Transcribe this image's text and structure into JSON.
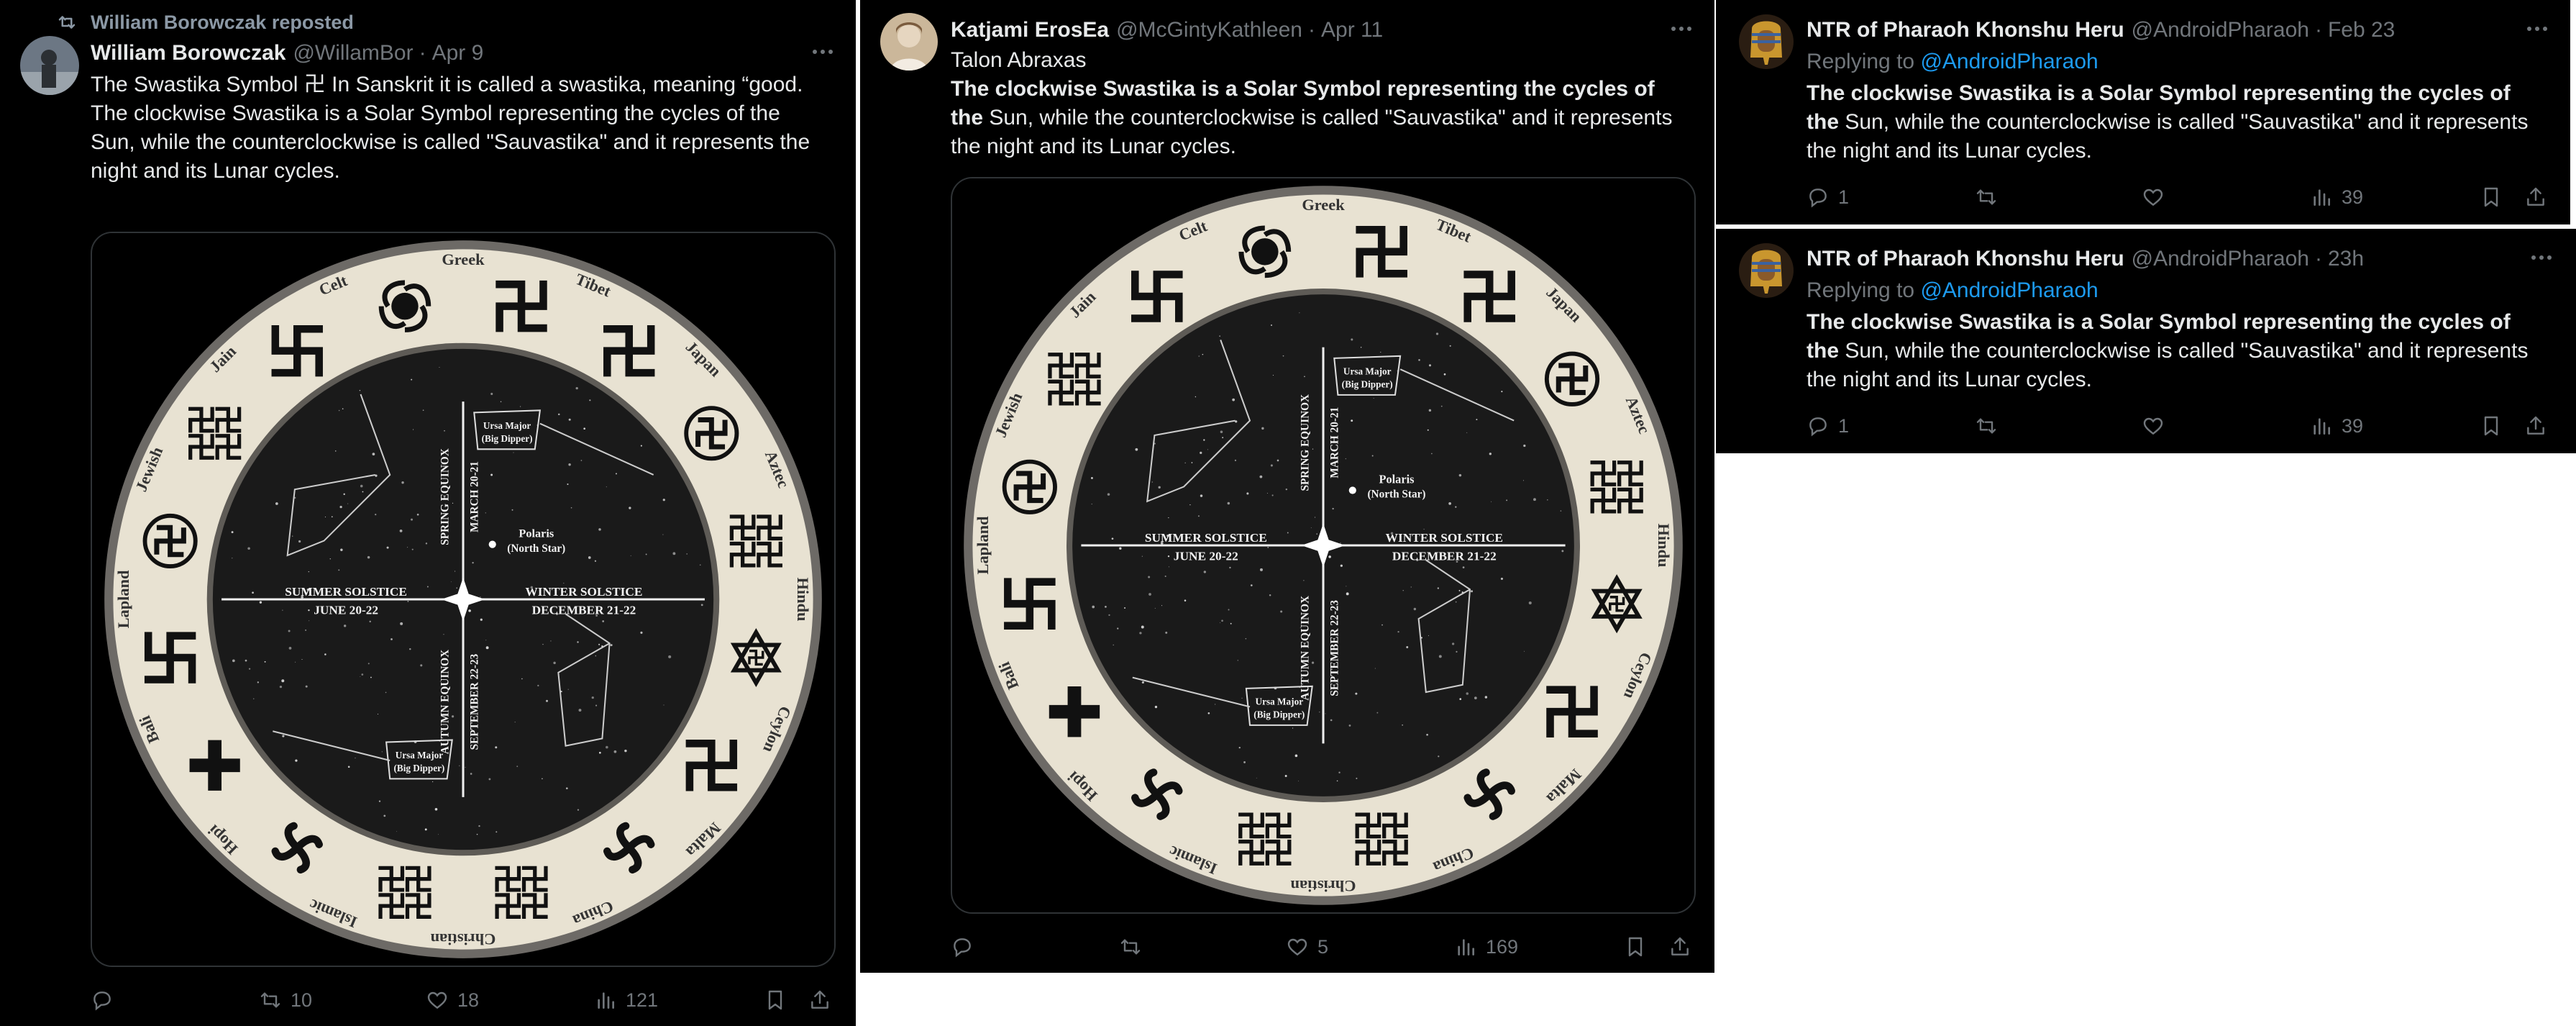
{
  "tweet1": {
    "repost_label": "William Borowczak reposted",
    "author_name": "William Borowczak",
    "handle": "@WillamBor",
    "separator": "·",
    "time": "Apr 9",
    "text_lines": [
      "The Swastika Symbol 卍 In Sanskrit it is called a swastika, meaning “good.",
      "The clockwise Swastika is a Solar Symbol representing the cycles of the",
      "Sun, while the counterclockwise is called \"Sauvastika\" and it represents the",
      "night and its Lunar cycles."
    ],
    "counts": {
      "replies": "",
      "reposts": "10",
      "likes": "18",
      "views": "121"
    }
  },
  "tweet2": {
    "author_name": "Katjami ErosEa",
    "handle": "@McGintyKathleen",
    "separator": "·",
    "time": "Apr 11",
    "text_lines": [
      "Talon Abraxas",
      "The clockwise Swastika is a Solar Symbol representing the cycles of",
      "the",
      " Sun, while the counterclockwise is called \"Sauvastika\" and it represents",
      "the night and its Lunar cycles."
    ],
    "counts": {
      "replies": "",
      "reposts": "",
      "likes": "5",
      "views": "169"
    }
  },
  "tweet3": {
    "author_name": "NTR of Pharaoh Khonshu Heru",
    "handle": "@AndroidPharaoh",
    "separator": "·",
    "time": "Feb 23",
    "replying_prefix": "Replying to",
    "replying_to": "@AndroidPharaoh",
    "text_lines": [
      "The clockwise Swastika is a Solar Symbol representing the cycles of",
      "the",
      " Sun, while the counterclockwise is called \"Sauvastika\" and it represents",
      "the night and its Lunar cycles."
    ],
    "counts": {
      "replies": "1",
      "reposts": "",
      "likes": "",
      "views": "39"
    }
  },
  "tweet4": {
    "author_name": "NTR of Pharaoh Khonshu Heru",
    "handle": "@AndroidPharaoh",
    "separator": "·",
    "time": "23h",
    "replying_prefix": "Replying to",
    "replying_to": "@AndroidPharaoh",
    "text_lines": [
      "The clockwise Swastika is a Solar Symbol representing the cycles of",
      "the",
      " Sun, while the counterclockwise is called \"Sauvastika\" and it represents",
      "the night and its Lunar cycles."
    ],
    "counts": {
      "replies": "1",
      "reposts": "",
      "likes": "",
      "views": "39"
    }
  },
  "media_chart": {
    "ring_labels": [
      "Greek",
      "Tibet",
      "Japan",
      "Aztec",
      "Hindu",
      "Ceylon",
      "Malta",
      "China",
      "Christian",
      "Islamic",
      "Hopi",
      "Bali",
      "Lapland",
      "Jewish",
      "Jain",
      "Celt"
    ],
    "star_labels": {
      "ursa_major": "Ursa Major",
      "big_dipper": "(Big Dipper)",
      "polaris": "Polaris",
      "north_star": "(North Star)",
      "summer_solstice": "SUMMER SOLSTICE",
      "summer_date": "JUNE 20-22",
      "winter_solstice": "WINTER SOLSTICE",
      "winter_date": "DECEMBER 21-22",
      "spring_equinox": "SPRING EQUINOX",
      "spring_date": "MARCH 20-21",
      "autumn_equinox": "AUTUMN EQUINOX",
      "autumn_date": "SEPTEMBER 22-23"
    }
  },
  "colors": {
    "background": "#000000",
    "text": "#e7e9ea",
    "secondary": "#71767b",
    "link": "#1d9bf0",
    "ring": "#e8e2d2",
    "sky": "#1a1a1a"
  },
  "icons": [
    "repost-icon",
    "more-icon",
    "reply-icon",
    "retweet-icon",
    "like-icon",
    "views-icon",
    "bookmark-icon",
    "share-icon"
  ]
}
